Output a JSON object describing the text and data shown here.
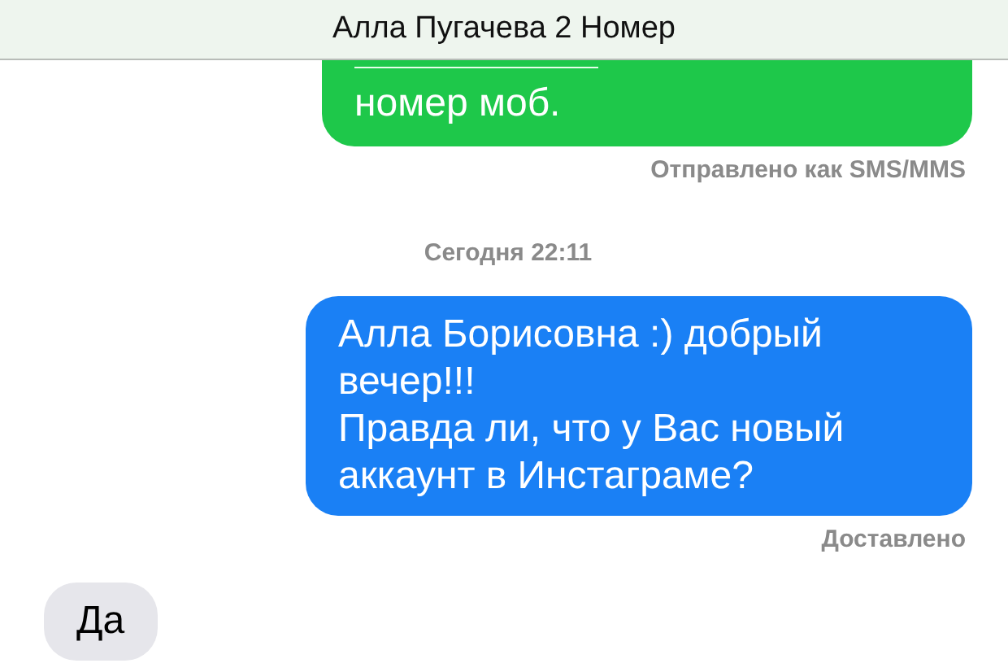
{
  "header": {
    "title": "Алла Пугачева 2 Номер"
  },
  "messages": [
    {
      "kind": "sent",
      "color": "#1ec84a",
      "text": "номер моб.",
      "cut_top": true,
      "status": "Отправлено как SMS/MMS"
    },
    {
      "kind": "timestamp",
      "text": "Сегодня 22:11"
    },
    {
      "kind": "sent",
      "color": "#1a80f5",
      "text": "Алла Борисовна :) добрый вечер!!!\nПравда ли, что у Вас новый аккаунт в Инстаграме?",
      "cut_top": false,
      "status": "Доставлено"
    },
    {
      "kind": "received",
      "text": "Да"
    }
  ]
}
